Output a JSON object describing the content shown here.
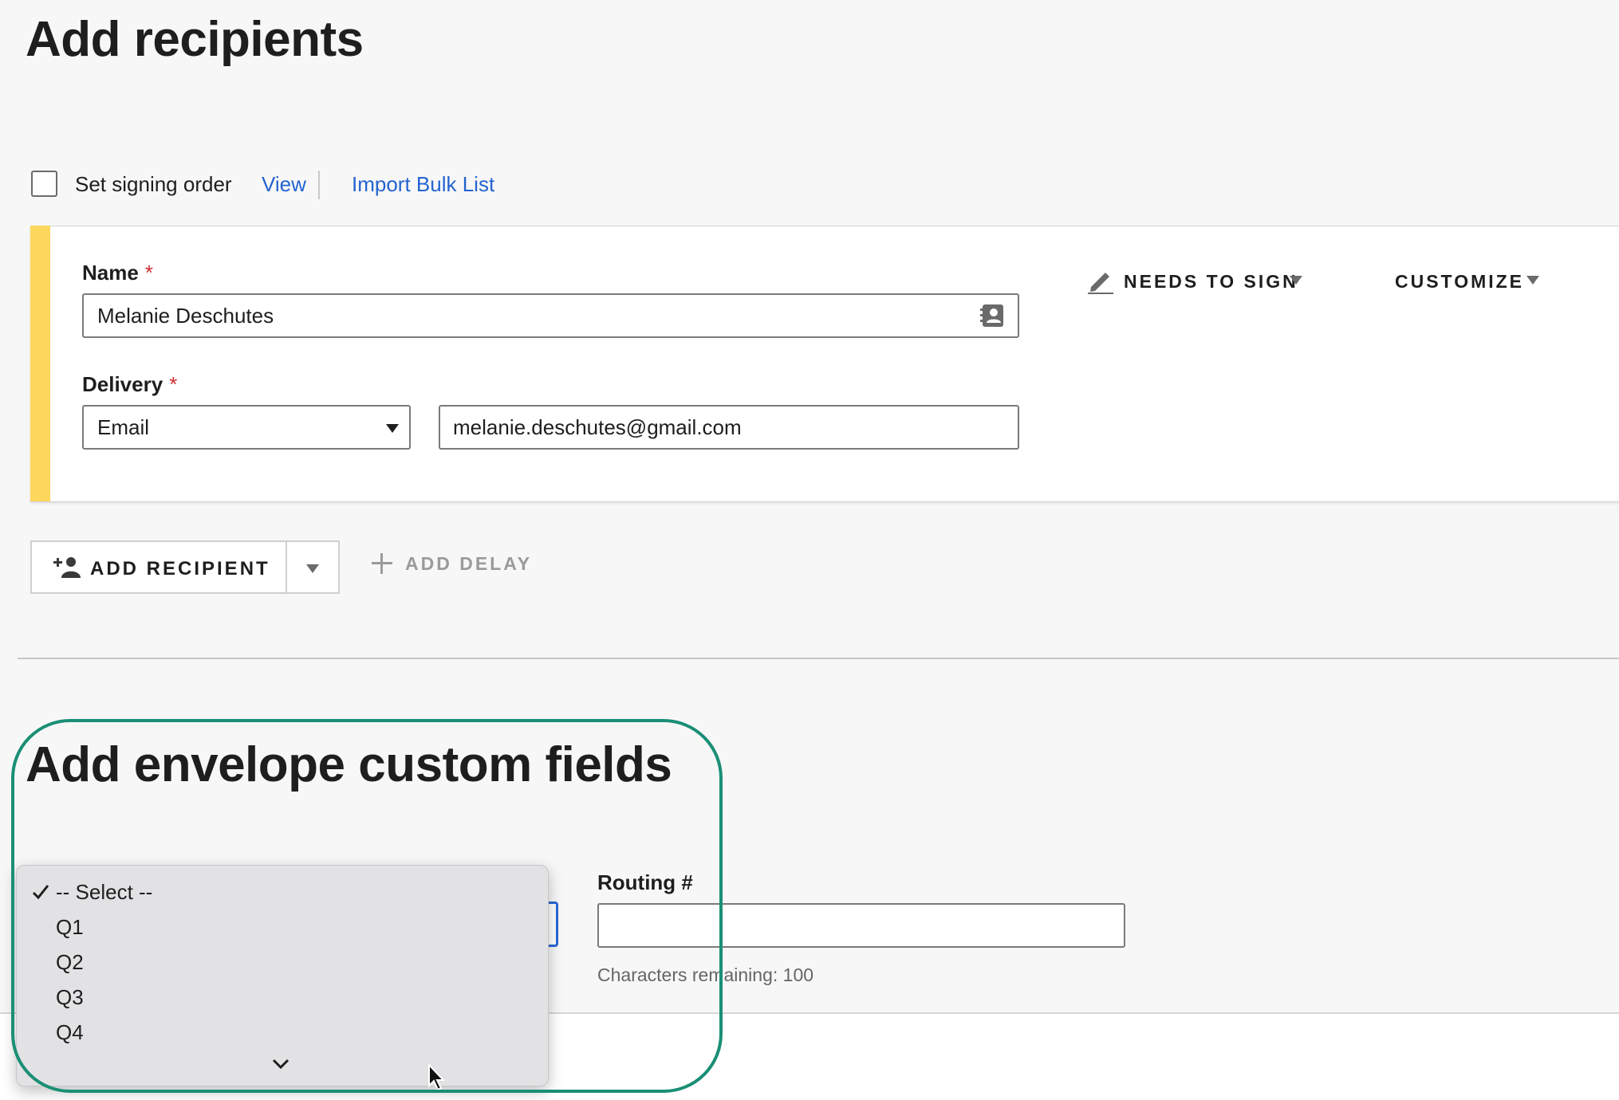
{
  "recipients_section": {
    "title": "Add recipients",
    "set_signing_order_label": "Set signing order",
    "view_link": "View",
    "import_bulk_list_link": "Import Bulk List"
  },
  "recipient_card": {
    "name_label": "Name",
    "required_mark": "*",
    "name_value": "Melanie Deschutes",
    "delivery_label": "Delivery",
    "delivery_value": "Email",
    "email_value": "melanie.deschutes@gmail.com",
    "action_label": "NEEDS TO SIGN",
    "customize_label": "CUSTOMIZE",
    "accent_color": "#fdd65c"
  },
  "actions": {
    "add_recipient_label": "ADD RECIPIENT",
    "add_delay_label": "ADD DELAY"
  },
  "custom_fields_section": {
    "title": "Add envelope custom fields",
    "dropdown_options": [
      "-- Select --",
      "Q1",
      "Q2",
      "Q3",
      "Q4"
    ],
    "selected_option": "-- Select --",
    "routing_label": "Routing #",
    "routing_value": "",
    "characters_remaining": "Characters remaining: 100"
  },
  "icons": [
    "pen-icon",
    "contact-card-icon",
    "add-person-icon",
    "plus-icon",
    "checkmark-icon",
    "chevron-down-icon",
    "cursor-icon"
  ],
  "colors": {
    "link": "#2463d1",
    "annotation": "#1a8f75",
    "required": "#cc2f2f",
    "focus": "#2a67d6"
  }
}
